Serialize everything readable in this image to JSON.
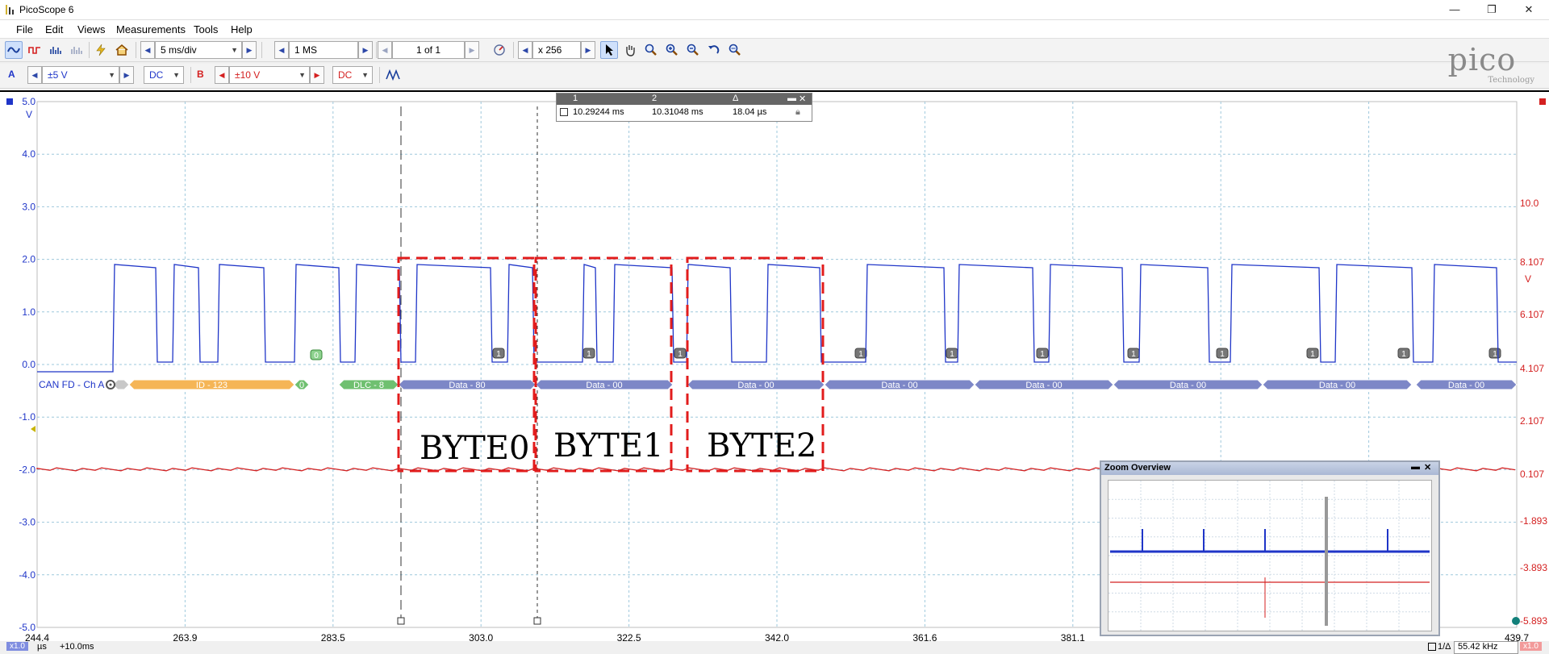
{
  "window": {
    "title": "PicoScope 6",
    "controls": {
      "minimize": "—",
      "maximize": "❐",
      "close": "✕"
    }
  },
  "menu": [
    {
      "label": "File"
    },
    {
      "label": "Edit"
    },
    {
      "label": "Views"
    },
    {
      "label": "Measurements"
    },
    {
      "label": "Tools"
    },
    {
      "label": "Help"
    }
  ],
  "toolbar": {
    "timebase": "5 ms/div",
    "samples": "1 MS",
    "buffer": "1 of 1",
    "zoom": "x 256"
  },
  "channels": {
    "a": {
      "label": "A",
      "range": "±5 V",
      "coupling": "DC",
      "color": "#1f35c8"
    },
    "b": {
      "label": "B",
      "range": "±10 V",
      "coupling": "DC",
      "color": "#d42020"
    }
  },
  "logo": {
    "word": "pico",
    "sub": "Technology"
  },
  "axes": {
    "left_unit": "V",
    "right_unit": "V",
    "left_ticks": [
      "5.0",
      "4.0",
      "3.0",
      "2.0",
      "1.0",
      "0.0",
      "-1.0",
      "-2.0",
      "-3.0",
      "-4.0",
      "-5.0"
    ],
    "right_ticks": [
      "10.0",
      "8.107",
      "6.107",
      "4.107",
      "2.107",
      "0.107",
      "-1.893",
      "-3.893",
      "-5.893"
    ],
    "x_ticks": [
      "244.4",
      "263.9",
      "283.5",
      "303.0",
      "322.5",
      "342.0",
      "361.6",
      "381.1",
      "439.7"
    ],
    "x_unit": "µs",
    "x_offset": "+10.0ms",
    "x_scale_badge": "x1.0"
  },
  "decoder": {
    "label": "CAN FD - Ch A",
    "packets": [
      "ID - 123",
      "0",
      "0",
      "DLC - 8",
      "Data - 80",
      "Data - 00",
      "Data - 00",
      "Data - 00",
      "Data - 00",
      "Data - 00",
      "Data - 00",
      "Data - 00"
    ],
    "stuff_marker": "1"
  },
  "annotations": {
    "byte0": "BYTE0",
    "byte1": "BYTE1",
    "byte2": "BYTE2"
  },
  "cursor_table": {
    "head": {
      "c1": "1",
      "c2": "2",
      "delta": "Δ"
    },
    "values": {
      "c1": "10.29244 ms",
      "c2": "10.31048 ms",
      "delta": "18.04 µs"
    }
  },
  "zoom_overview": {
    "title": "Zoom Overview"
  },
  "status": {
    "frequency": "55.42 kHz",
    "cursor_mode": "1/Δ",
    "right_badge": "x1.0"
  }
}
